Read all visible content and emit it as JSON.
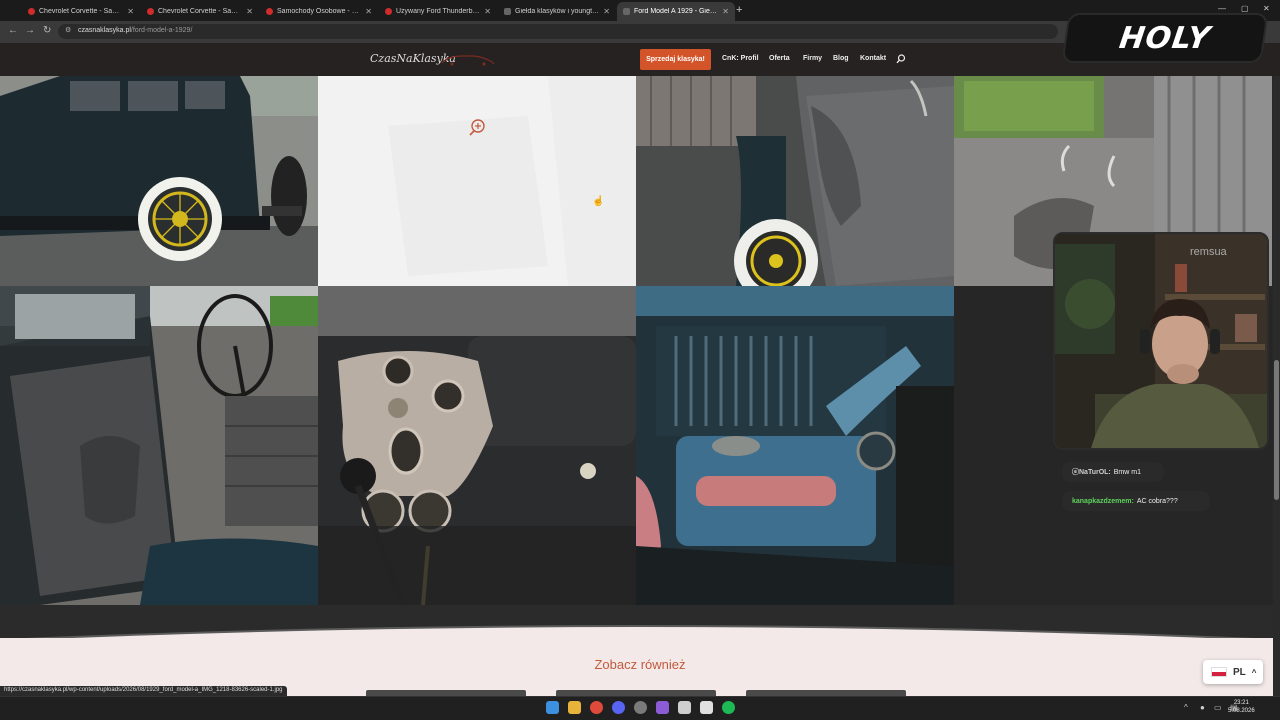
{
  "browser": {
    "tabs": [
      {
        "title": "Chevrolet Corvette - Samochod...",
        "active": false
      },
      {
        "title": "Chevrolet Corvette - Samochod...",
        "active": false
      },
      {
        "title": "Samochody Osobowe - Otomo...",
        "active": false
      },
      {
        "title": "Używany Ford Thunderbird 19...",
        "active": false
      },
      {
        "title": "Giełda klasyków i youngtimerów...",
        "active": false
      },
      {
        "title": "Ford Model A 1929 - Giełda C...",
        "active": true
      }
    ],
    "url_domain": "czasnaklasyka.pl",
    "url_path": "/ford-model-a-1929/",
    "status_url": "https://czasnaklasyka.pl/wp-content/uploads/2026/08/1929_ford_model-a_IMG_1218-83626-scaled-1.jpg"
  },
  "site": {
    "logo": "CzasNaKlasyka",
    "sell_button": "Sprzedaj klasyka!",
    "nav": [
      "CnK: Profil",
      "Oferta",
      "Firmy",
      "Blog",
      "Kontakt"
    ],
    "see_also_heading": "Zobacz również",
    "language": "PL"
  },
  "stream": {
    "logo_text": "HOLY",
    "webcam_sign": "remsua",
    "chat": [
      {
        "user": "ⓔNaTurOL:",
        "message": "Bmw m1",
        "color": "#cfcfcf"
      },
      {
        "user": "kanapkazdzemem:",
        "message": "AC cobra???",
        "color": "#5fd35f"
      }
    ]
  },
  "taskbar": {
    "time": "23:21",
    "date": "5.08.2026"
  },
  "colors": {
    "accent": "#d4542a",
    "heading": "#c35a3c"
  }
}
